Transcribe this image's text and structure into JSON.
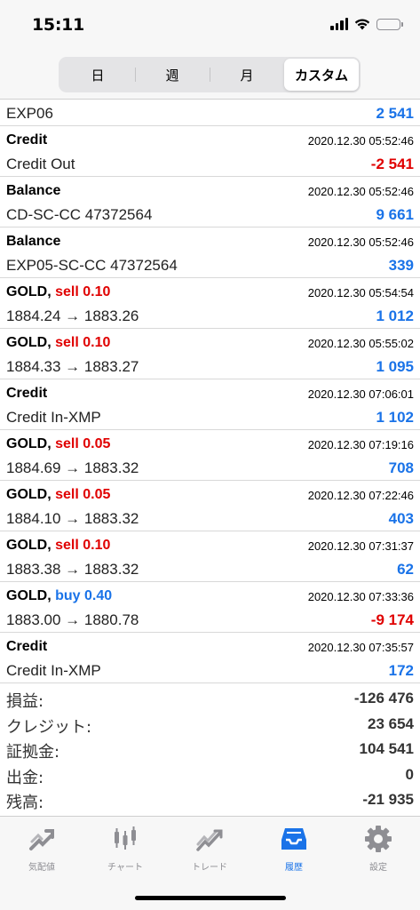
{
  "status_bar": {
    "time": "15:11"
  },
  "period_tabs": [
    {
      "label": "日",
      "active": false
    },
    {
      "label": "週",
      "active": false
    },
    {
      "label": "月",
      "active": false
    },
    {
      "label": "カスタム",
      "active": true
    }
  ],
  "history": {
    "first_row": {
      "desc": "EXP06",
      "amount": "2 541"
    },
    "rows": [
      {
        "title": "Credit",
        "op": "",
        "date": "2020.12.30 05:52:46",
        "desc": "Credit Out",
        "amount": "-2 541"
      },
      {
        "title": "Balance",
        "op": "",
        "date": "2020.12.30 05:52:46",
        "desc": "CD-SC-CC 47372564",
        "amount": "9 661"
      },
      {
        "title": "Balance",
        "op": "",
        "date": "2020.12.30 05:52:46",
        "desc": "EXP05-SC-CC 47372564",
        "amount": "339"
      },
      {
        "title": "GOLD,",
        "op": "sell 0.10",
        "date": "2020.12.30 05:54:54",
        "desc": "1884.24 → 1883.26",
        "amount": "1 012"
      },
      {
        "title": "GOLD,",
        "op": "sell 0.10",
        "date": "2020.12.30 05:55:02",
        "desc": "1884.33 → 1883.27",
        "amount": "1 095"
      },
      {
        "title": "Credit",
        "op": "",
        "date": "2020.12.30 07:06:01",
        "desc": "Credit In-XMP",
        "amount": "1 102"
      },
      {
        "title": "GOLD,",
        "op": "sell 0.05",
        "date": "2020.12.30 07:19:16",
        "desc": "1884.69 → 1883.32",
        "amount": "708"
      },
      {
        "title": "GOLD,",
        "op": "sell 0.05",
        "date": "2020.12.30 07:22:46",
        "desc": "1884.10 → 1883.32",
        "amount": "403"
      },
      {
        "title": "GOLD,",
        "op": "sell 0.10",
        "date": "2020.12.30 07:31:37",
        "desc": "1883.38 → 1883.32",
        "amount": "62"
      },
      {
        "title": "GOLD,",
        "op": "buy 0.40",
        "date": "2020.12.30 07:33:36",
        "desc": "1883.00 → 1880.78",
        "amount": "-9 174"
      },
      {
        "title": "Credit",
        "op": "",
        "date": "2020.12.30 07:35:57",
        "desc": "Credit In-XMP",
        "amount": "172"
      }
    ]
  },
  "summary": [
    {
      "label": "損益:",
      "value": "-126 476"
    },
    {
      "label": "クレジット:",
      "value": "23 654"
    },
    {
      "label": "証拠金:",
      "value": "104 541"
    },
    {
      "label": "出金:",
      "value": "0"
    },
    {
      "label": "残高:",
      "value": "-21 935"
    }
  ],
  "tabbar": [
    {
      "label": "気配値",
      "icon": "quotes-icon",
      "active": false
    },
    {
      "label": "チャート",
      "icon": "chart-icon",
      "active": false
    },
    {
      "label": "トレード",
      "icon": "trade-icon",
      "active": false
    },
    {
      "label": "履歴",
      "icon": "history-icon",
      "active": true
    },
    {
      "label": "設定",
      "icon": "settings-icon",
      "active": false
    }
  ],
  "colors": {
    "positive": "#1a73e8",
    "negative": "#e00000",
    "active_tab": "#1a73e8",
    "inactive_tab": "#8e8e93"
  }
}
